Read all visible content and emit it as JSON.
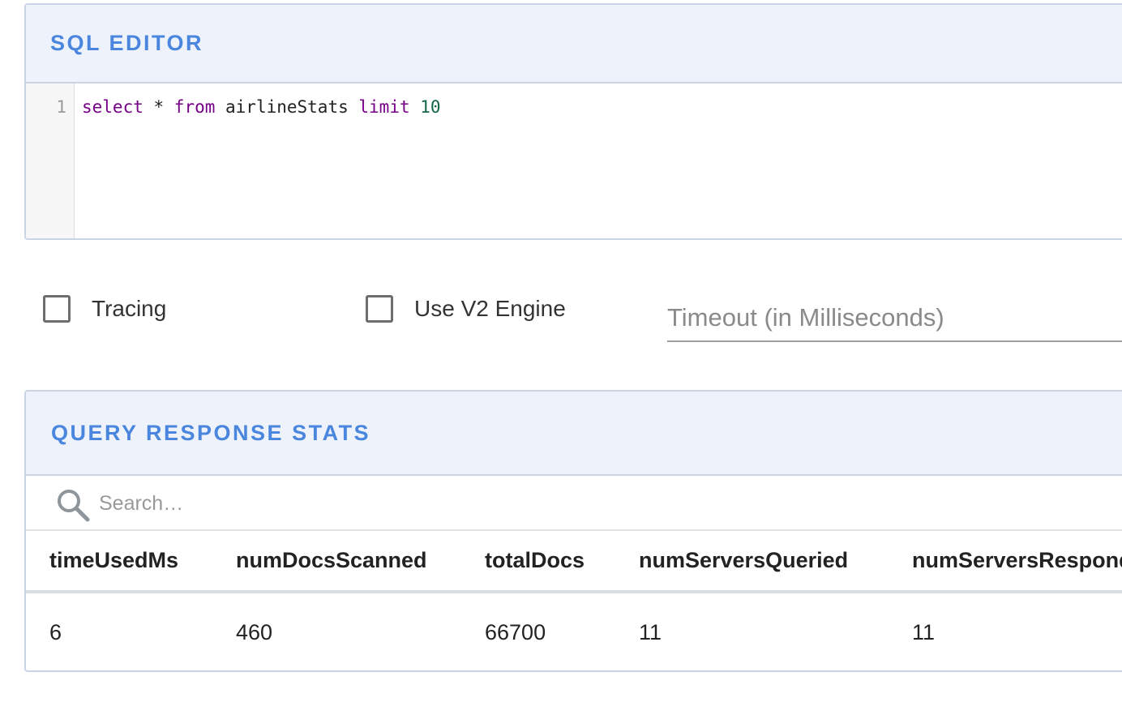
{
  "editor": {
    "title": "SQL EDITOR",
    "line_numbers": [
      "1"
    ],
    "query": {
      "kw_select": "select",
      "star": " * ",
      "kw_from": "from",
      "table": " airlineStats ",
      "kw_limit": "limit",
      "limit_value": " 10"
    }
  },
  "options": {
    "tracing_label": "Tracing",
    "v2_engine_label": "Use V2 Engine",
    "timeout_placeholder": "Timeout (in Milliseconds)",
    "timeout_value": ""
  },
  "stats": {
    "title": "QUERY RESPONSE STATS",
    "search_placeholder": "Search…",
    "columns": [
      "timeUsedMs",
      "numDocsScanned",
      "totalDocs",
      "numServersQueried",
      "numServersResponded"
    ],
    "rows": [
      [
        "6",
        "460",
        "66700",
        "11",
        "11"
      ]
    ]
  },
  "icons": {
    "search": "search-icon",
    "checkbox": "checkbox-icon"
  },
  "colors": {
    "accent": "#4a86de",
    "header_bg": "#edf2fb",
    "keyword": "#770088",
    "number": "#116644"
  }
}
